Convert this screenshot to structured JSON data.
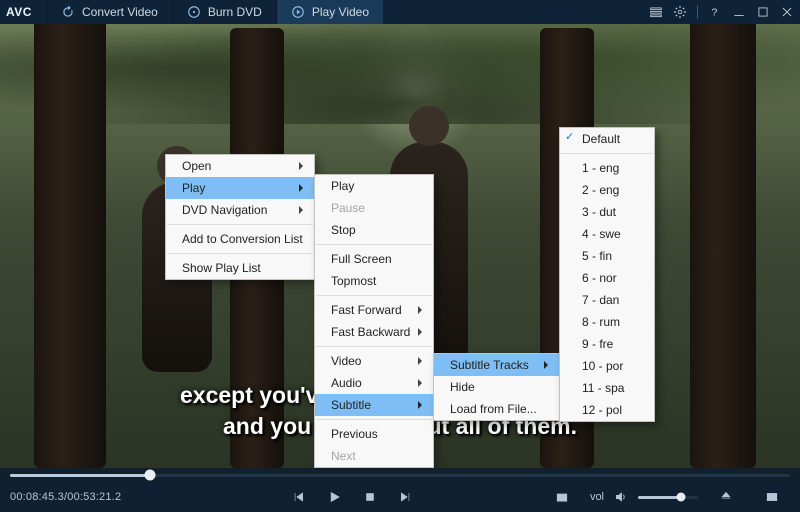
{
  "brand": "AVC",
  "tabs": {
    "convert": "Convert Video",
    "burn": "Burn DVD",
    "play": "Play Video"
  },
  "subtitle": {
    "line1": "except you've got thousands of children",
    "line2": "and you worry about all of them."
  },
  "context_menu": {
    "open": "Open",
    "play": "Play",
    "dvd_nav": "DVD Navigation",
    "add_conv": "Add to Conversion List",
    "show_playlist": "Show Play List"
  },
  "play_menu": {
    "play": "Play",
    "pause": "Pause",
    "stop": "Stop",
    "fullscreen": "Full Screen",
    "topmost": "Topmost",
    "ff": "Fast Forward",
    "fb": "Fast Backward",
    "video": "Video",
    "audio": "Audio",
    "subtitle": "Subtitle",
    "previous": "Previous",
    "next": "Next"
  },
  "subtitle_menu": {
    "tracks": "Subtitle Tracks",
    "hide": "Hide",
    "load": "Load from File..."
  },
  "tracks_menu": {
    "default": "Default",
    "items": [
      "1 - eng",
      "2 - eng",
      "3 - dut",
      "4 - swe",
      "5 - fin",
      "6 - nor",
      "7 - dan",
      "8 - rum",
      "9 - fre",
      "10 - por",
      "11 - spa",
      "12 - pol"
    ]
  },
  "playback": {
    "current": "00:08:45.3",
    "total": "00:53:21.2"
  },
  "volume_label": "vol"
}
